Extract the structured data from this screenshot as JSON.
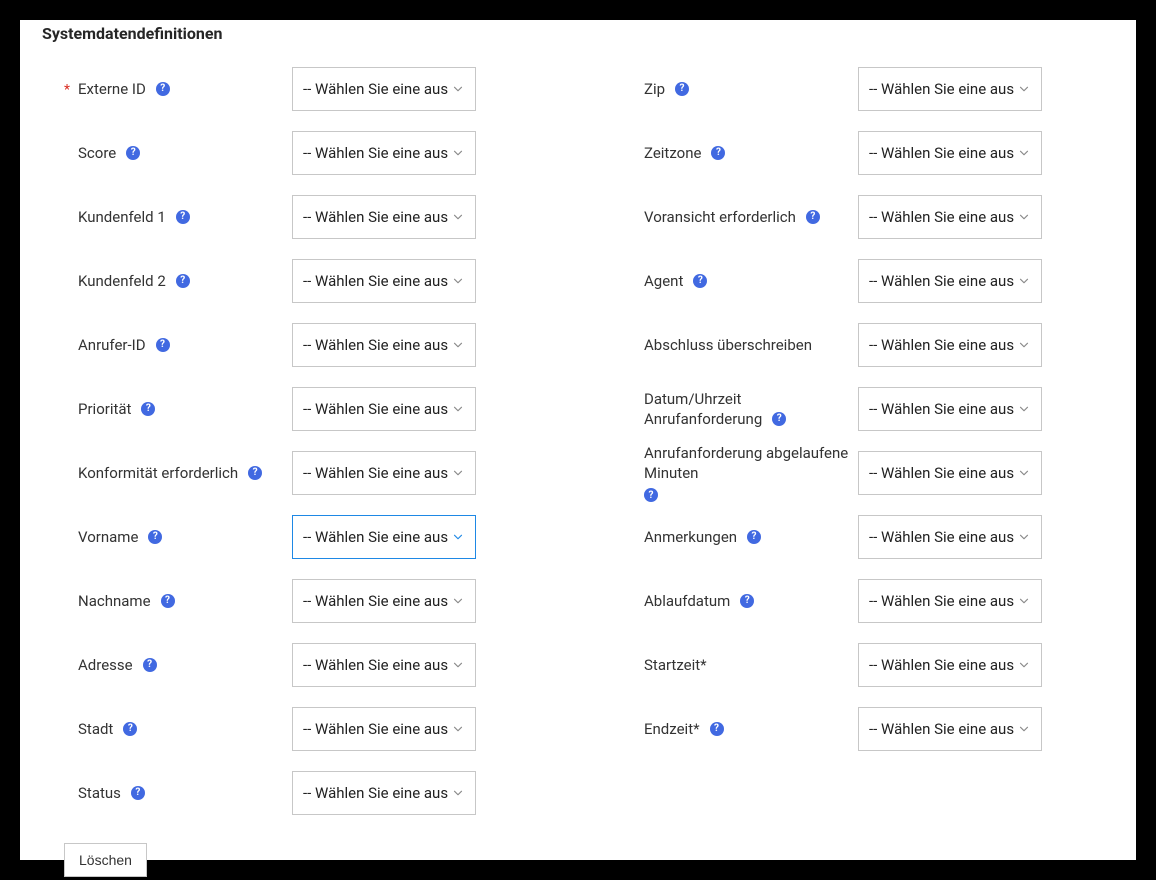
{
  "section_title": "Systemdatendefinitionen",
  "select_placeholder": "-- Wählen Sie eine aus --",
  "delete_button": "Löschen",
  "left_fields": [
    {
      "id": "externe-id",
      "label": "Externe ID",
      "required": true,
      "active": false
    },
    {
      "id": "score",
      "label": "Score",
      "required": false,
      "active": false
    },
    {
      "id": "kundenfeld-1",
      "label": "Kundenfeld 1",
      "required": false,
      "active": false
    },
    {
      "id": "kundenfeld-2",
      "label": "Kundenfeld 2",
      "required": false,
      "active": false
    },
    {
      "id": "anrufer-id",
      "label": "Anrufer-ID",
      "required": false,
      "active": false
    },
    {
      "id": "prioritaet",
      "label": "Priorität",
      "required": false,
      "active": false
    },
    {
      "id": "konformitaet",
      "label": "Konformität erforderlich",
      "required": false,
      "active": false
    },
    {
      "id": "vorname",
      "label": "Vorname",
      "required": false,
      "active": true
    },
    {
      "id": "nachname",
      "label": "Nachname",
      "required": false,
      "active": false
    },
    {
      "id": "adresse",
      "label": "Adresse",
      "required": false,
      "active": false
    },
    {
      "id": "stadt",
      "label": "Stadt",
      "required": false,
      "active": false
    },
    {
      "id": "status",
      "label": "Status",
      "required": false,
      "active": false
    }
  ],
  "right_fields": [
    {
      "id": "zip",
      "label": "Zip",
      "required": false,
      "active": false,
      "help_below": false
    },
    {
      "id": "zeitzone",
      "label": "Zeitzone",
      "required": false,
      "active": false,
      "help_below": false
    },
    {
      "id": "voransicht",
      "label": "Voransicht erforderlich",
      "required": false,
      "active": false,
      "help_below": false
    },
    {
      "id": "agent",
      "label": "Agent",
      "required": false,
      "active": false,
      "help_below": false
    },
    {
      "id": "abschluss",
      "label": "Abschluss überschreiben",
      "required": false,
      "active": false,
      "no_help": true
    },
    {
      "id": "datum-uhrzeit",
      "label": "Datum/Uhrzeit Anrufanforderung",
      "required": false,
      "active": false,
      "help_below": false
    },
    {
      "id": "anrufanforderung-min",
      "label": "Anrufanforderung abgelaufene Minuten",
      "required": false,
      "active": false,
      "help_below": true
    },
    {
      "id": "anmerkungen",
      "label": "Anmerkungen",
      "required": false,
      "active": false,
      "help_below": false
    },
    {
      "id": "ablaufdatum",
      "label": "Ablaufdatum",
      "required": false,
      "active": false,
      "help_below": false
    },
    {
      "id": "startzeit",
      "label": "Startzeit*",
      "required": false,
      "active": false,
      "no_help": true
    },
    {
      "id": "endzeit",
      "label": "Endzeit*",
      "required": false,
      "active": false,
      "help_below": false
    }
  ]
}
